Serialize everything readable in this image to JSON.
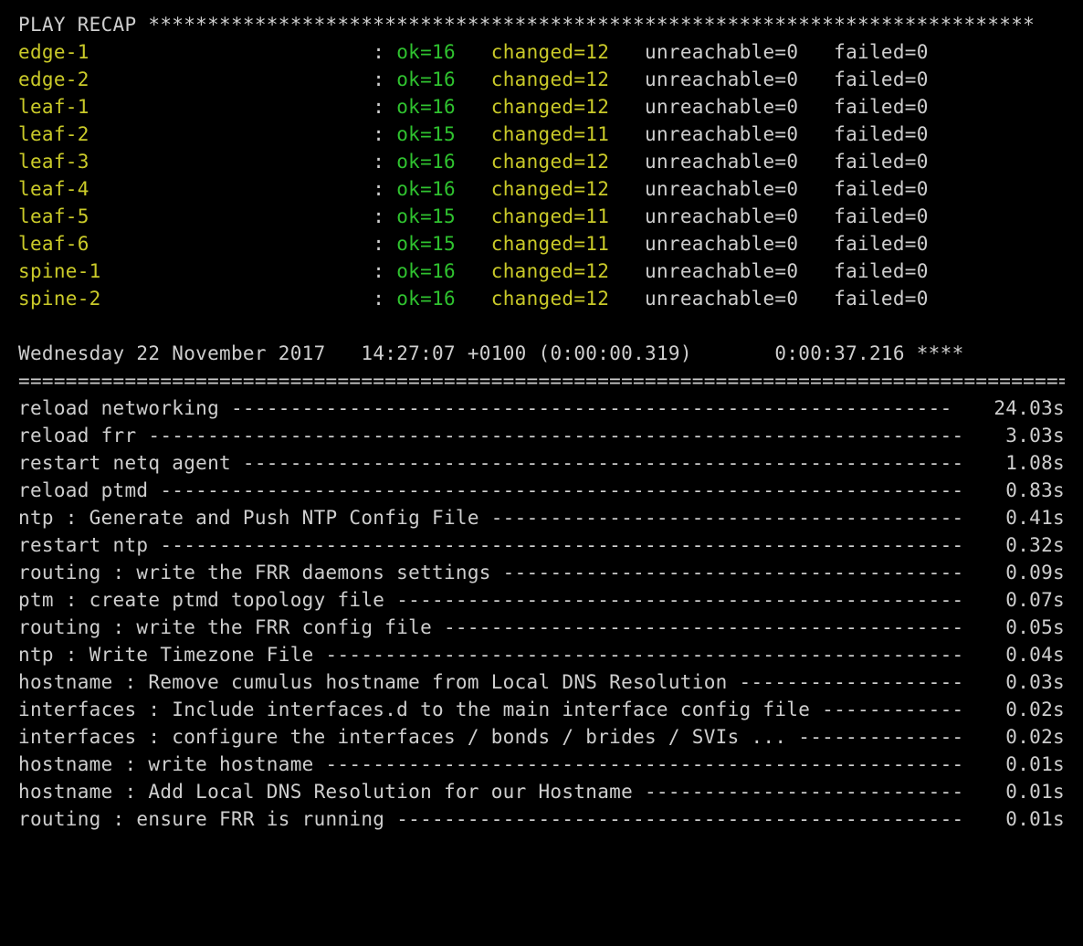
{
  "recap": {
    "header_label": "PLAY RECAP",
    "header_stars": " ***************************************************************************",
    "hosts": [
      {
        "name": "edge-1",
        "ok": 16,
        "changed": 12,
        "unreachable": 0,
        "failed": 0
      },
      {
        "name": "edge-2",
        "ok": 16,
        "changed": 12,
        "unreachable": 0,
        "failed": 0
      },
      {
        "name": "leaf-1",
        "ok": 16,
        "changed": 12,
        "unreachable": 0,
        "failed": 0
      },
      {
        "name": "leaf-2",
        "ok": 15,
        "changed": 11,
        "unreachable": 0,
        "failed": 0
      },
      {
        "name": "leaf-3",
        "ok": 16,
        "changed": 12,
        "unreachable": 0,
        "failed": 0
      },
      {
        "name": "leaf-4",
        "ok": 16,
        "changed": 12,
        "unreachable": 0,
        "failed": 0
      },
      {
        "name": "leaf-5",
        "ok": 15,
        "changed": 11,
        "unreachable": 0,
        "failed": 0
      },
      {
        "name": "leaf-6",
        "ok": 15,
        "changed": 11,
        "unreachable": 0,
        "failed": 0
      },
      {
        "name": "spine-1",
        "ok": 16,
        "changed": 12,
        "unreachable": 0,
        "failed": 0
      },
      {
        "name": "spine-2",
        "ok": 16,
        "changed": 12,
        "unreachable": 0,
        "failed": 0
      }
    ]
  },
  "timestamp": {
    "date": "Wednesday 22 November 2017",
    "time": "14:27:07 +0100",
    "step_elapsed": "(0:00:00.319)",
    "total_elapsed": "0:00:37.216",
    "stars": "****"
  },
  "divider": "===============================================================================================",
  "tasks": [
    {
      "name": "reload networking",
      "time": "24.03s"
    },
    {
      "name": "reload frr",
      "time": "3.03s"
    },
    {
      "name": "restart netq agent",
      "time": "1.08s"
    },
    {
      "name": "reload ptmd",
      "time": "0.83s"
    },
    {
      "name": "ntp : Generate and Push NTP Config File",
      "time": "0.41s"
    },
    {
      "name": "restart ntp",
      "time": "0.32s"
    },
    {
      "name": "routing : write the FRR daemons settings",
      "time": "0.09s"
    },
    {
      "name": "ptm : create ptmd topology file",
      "time": "0.07s"
    },
    {
      "name": "routing : write the FRR config file",
      "time": "0.05s"
    },
    {
      "name": "ntp : Write Timezone File",
      "time": "0.04s"
    },
    {
      "name": "hostname : Remove cumulus hostname from Local DNS Resolution",
      "time": "0.03s"
    },
    {
      "name": "interfaces : Include interfaces.d to the main interface config file",
      "time": "0.02s"
    },
    {
      "name": "interfaces : configure the interfaces / bonds / brides / SVIs ...",
      "time": "0.02s"
    },
    {
      "name": "hostname : write hostname",
      "time": "0.01s"
    },
    {
      "name": "hostname : Add Local DNS Resolution for our Hostname",
      "time": "0.01s"
    },
    {
      "name": "routing : ensure FRR is running",
      "time": "0.01s"
    }
  ]
}
